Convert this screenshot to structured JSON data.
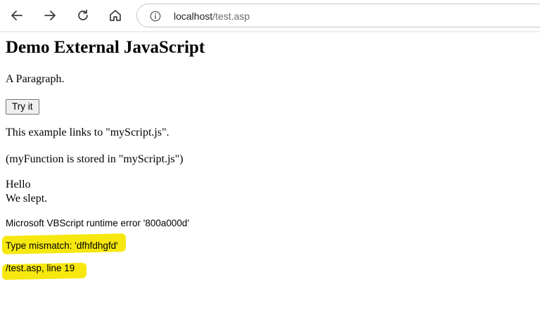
{
  "browser": {
    "back_icon": "arrow-left-icon",
    "forward_icon": "arrow-right-icon",
    "reload_icon": "reload-icon",
    "home_icon": "home-icon",
    "info_icon": "info-icon",
    "url_host": "localhost",
    "url_path": "/test.asp"
  },
  "page": {
    "heading": "Demo External JavaScript",
    "paragraph": "A Paragraph.",
    "button_label": "Try it",
    "link_note": "This example links to \"myScript.js\".",
    "store_note": "(myFunction is stored in \"myScript.js\")",
    "hello": "Hello",
    "slept": "We slept.",
    "error_title": "Microsoft VBScript runtime error '800a000d'",
    "error_message": "Type mismatch: 'dfhfdhgfd'",
    "error_location": "/test.asp, line 19"
  },
  "colors": {
    "highlight": "#f6e80f"
  }
}
